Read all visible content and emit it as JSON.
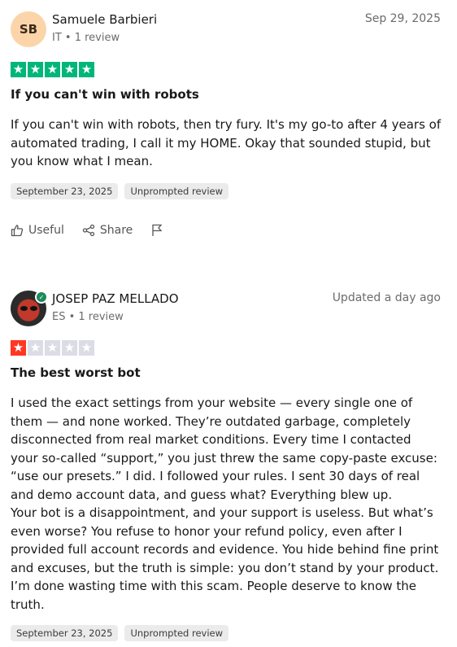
{
  "reviews": [
    {
      "avatar_initials": "SB",
      "name": "Samuele Barbieri",
      "meta": "IT • 1 review",
      "date": "Sep 29, 2025",
      "rating": 5,
      "rating_color": "#00b67a",
      "title": "If you can't win with robots",
      "body": "If you can't win with robots, then try fury. It's my go-to after 4 years of automated trading, I call it my HOME. Okay that sounded stupid, but you know what I mean.",
      "tags": [
        "September 23, 2025",
        "Unprompted review"
      ],
      "actions": {
        "useful": "Useful",
        "share": "Share"
      }
    },
    {
      "name": "JOSEP PAZ MELLADO",
      "meta": "ES • 1 review",
      "date": "Updated a day ago",
      "rating": 1,
      "rating_color": "#ff3722",
      "title": "The best worst bot",
      "body": "I used the exact settings from your website — every single one of them — and none worked. They’re outdated garbage, completely disconnected from real market conditions. Every time I contacted your so-called “support,” you just threw the same copy-paste excuse: “use our presets.” I did. I followed your rules. I sent 30 days of real and demo account data, and guess what? Everything blew up.\nYour bot is a disappointment, and your support is useless. But what’s even worse? You refuse to honor your refund policy, even after I provided full account records and evidence. You hide behind fine print and excuses, but the truth is simple: you don’t stand by your product. I’m done wasting time with this scam. People deserve to know the truth.",
      "tags": [
        "September 23, 2025",
        "Unprompted review"
      ]
    }
  ]
}
